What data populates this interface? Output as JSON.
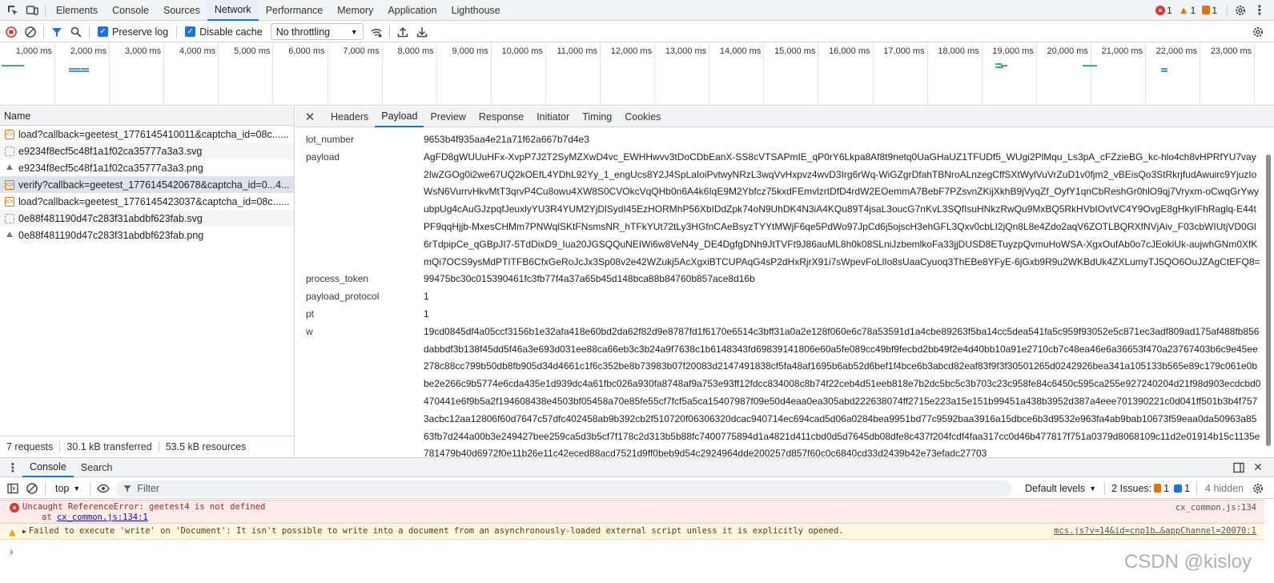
{
  "top_tabs": [
    "Elements",
    "Console",
    "Sources",
    "Network",
    "Performance",
    "Memory",
    "Application",
    "Lighthouse"
  ],
  "active_top_tab": "Network",
  "counters": {
    "errors": "1",
    "warnings": "1",
    "issues": "1"
  },
  "toolbar": {
    "preserve_log": "Preserve log",
    "disable_cache": "Disable cache",
    "throttling": "No throttling"
  },
  "timeline_ticks": [
    "1,000 ms",
    "2,000 ms",
    "3,000 ms",
    "4,000 ms",
    "5,000 ms",
    "6,000 ms",
    "7,000 ms",
    "8,000 ms",
    "9,000 ms",
    "10,000 ms",
    "11,000 ms",
    "12,000 ms",
    "13,000 ms",
    "14,000 ms",
    "15,000 ms",
    "16,000 ms",
    "17,000 ms",
    "18,000 ms",
    "19,000 ms",
    "20,000 ms",
    "21,000 ms",
    "22,000 ms",
    "23,000 ms"
  ],
  "requests_header": "Name",
  "requests": [
    {
      "name": "load?callback=geetest_1776145410011&captcha_id=08c......",
      "type": "script"
    },
    {
      "name": "e9234f8ecf5c48f1a1f02ca35777a3a3.svg",
      "type": "img"
    },
    {
      "name": "e9234f8ecf5c48f1a1f02ca35777a3a3.png",
      "type": "png"
    },
    {
      "name": "verify?callback=geetest_1776145420678&captcha_id=0...4...",
      "type": "script"
    },
    {
      "name": "load?callback=geetest_1776145423037&captcha_id=08c......",
      "type": "script"
    },
    {
      "name": "0e88f481190d47c283f31abdbf623fab.svg",
      "type": "img"
    },
    {
      "name": "0e88f481190d47c283f31abdbf623fab.png",
      "type": "png"
    }
  ],
  "status": {
    "requests": "7 requests",
    "transferred": "30.1 kB transferred",
    "resources": "53.5 kB resources"
  },
  "detail_tabs": [
    "Headers",
    "Payload",
    "Preview",
    "Response",
    "Initiator",
    "Timing",
    "Cookies"
  ],
  "active_detail_tab": "Payload",
  "payload": [
    {
      "key": "lot_number",
      "value": "9653b4f935aa4e21a71f62a667b7d4e3"
    },
    {
      "key": "payload",
      "value": "AgFD8gWUUuHFx-XvpP7J2T2SyMZXwD4vc_EWHHwvv3tDoCDbEanX-SS8cVTSAPmIE_qP0rY6Lkpa8Af8t9netq0UaGHaUZ1TFUDf5_WUgi2PlMqu_Ls3pA_cFZzieBG_kc-hlo4ch8vHPRfYU7vay2IwZGOg0i2we67UQ2kOEfL4YDhL92Yy_1_engUcs8Y2J4SpLaIoiPvtwyNRzL3wqVvHxpvz4wvD3Irg6rWq-WiGZgrDfahTBNroALnzegCffSXtWylVuVrZuD1v0fjm2_vBEisQo3StRkrjfudAwuirc9YjuzIoWsN6VurrvHkvMtT3qrvP4Cu8owu4XW8S0CVOkcVqQHb0n6A4k6IqE9M2Ybfcz75kxdFEmvlzrtDfD4rdW2EOemmA7BebF7PZsvnZKijXkhB9jVyqZf_OyfY1qnCbReshGr0hlO9qj7Vryxm-oCwqGrYwyubpUg4cAuGJzpqfJeuxlyYU3R4YUM2YjDlSydI45EzHORMhP56XbIDdZpk74oN9UhDK4N3iA4KQu89T4jsaL3oucG7nKvL3SQfIsuHNkzRwQu9MxBQ5RkHVbIOvtVC4Y9OvgE8gHkyIFhRaglq-E44tPF9qqHjjb-MxesCHMm7PNWqlSKtFNsmsNR_hTFkYUt72tLy3HGfnCAeBsyzTYYtMWjF6qe5PdWo97JpCd6j5ojscH3ehGFL3Qxv0cbLI2jQn8L8e4Zdo2aqV6ZOTLBQRXfNVjAiv_F03cbWIUtjVD0Gl6rTdpipCe_qGBpJI7-5TdDixD9_Iua20JGSQQuNEIWi6w8VeN4y_DE4DgfgDNh9JtTVFt9J86auML8h0k08SLniJzbemlkoFa33jjDUSD8ETuyzpQvmuHoWSA-XgxOufAb0o7cJEokiUk-aujwhGNm0XfKmQi7OCS9ysMdPTITFB6CfxGeRoJcJx3Sp08v2e42WZukj5AcXgxiBTCUPAqG4sP2dHxRjrX91i7sWpevFoLlIo8sUaaCyuoq3ThEBe8YFyE-6jGxb9R9u2WKBdUk4ZXLumyTJ5QO6OuJZAgCtEFQ8="
    },
    {
      "key": "process_token",
      "value": "99475bc30c015390461fc3fb77f4a37a65b45d148bca88b84760b857ace8d16b"
    },
    {
      "key": "payload_protocol",
      "value": "1"
    },
    {
      "key": "pt",
      "value": "1"
    },
    {
      "key": "w",
      "value": "19cd0845df4a05ccf3156b1e32afa418e60bd2da62f82d9e8787fd1f6170e6514c3bff31a0a2e128f060e6c78a53591d1a4cbe89263f5ba14cc5dea541fa5c959f93052e5c871ec3adf809ad175af488fb856dabbdf3b138f45dd5f46a3e693d031ee88ca66eb3c3b24a9f7638c1b6148343fd69839141806e60a5fe089cc49bf9fecbd2bb49f2e4d40bb10a91e2710cb7c48ea46e6a36653f470a23767403b6c9e45ee278c88cc799b50db8fb905d34d4661c1f6c352be8b73983b07f20083d2147491838cf5fa48af1695b6ab52d6bef1f4bce6b3abcd82eaf83f9f3f30501265d0242926bea341a105133b565e89c179c061e0bbe2e266c9b5774e6cda435e1d939dc4a61fbc026a930fa8748af9a753e93ff12fdcc834008c8b74f22ceb4d51eeb818e7b2dc5bc5c3b703c23c958fe84c6450c595ca255e927240204d21f98d903ecdcbd0470441e6f9b5a2f194608438e4503bf05458a70e85fe55cf7fcf5a5ca15407987f09e50d4eaa0ea305abd222638074ff2715e223a15e151b99451a438b3952d387a4eee701390221c0d041ff501b3b4f7573acbc12aa12806f60d7647c57dfc402458ab9b392cb2f510720f06306320dcac940714ec694cad5d06a0284bea9951bd77c9592baa3916a15dbce6b3d9532e963fa4ab9bab10673f59eaa0da50963a8563fb7d244a00b3e249427bee259ca5d3b5cf7f178c2d313b5b88fc7400775894d1a4821d411cbd0d5d7645db08dfe8c437f204fcdf4faa317cc0d46b477817f751a0379d8068109c11d2e01914b15c1135e781479b40d6972f0e11b26e11c42eced88acd7521d9ff0beb9d54c2924964dde200257d857f60c0c6840cd33d2439b42e73efadc27703"
    }
  ],
  "drawer": {
    "tabs": [
      "Console",
      "Search"
    ],
    "active": "Console",
    "context": "top",
    "filter_placeholder": "Filter",
    "levels": "Default levels",
    "issues_label": "2 Issues:",
    "issues_warn": "1",
    "issues_info": "1",
    "hidden": "4 hidden"
  },
  "console_messages": {
    "error": {
      "text": "Uncaught ReferenceError: geetest4 is not defined",
      "at_prefix": "at ",
      "at_link": "cx_common.js:134:1",
      "source": "cx_common.js:134"
    },
    "warning": {
      "text": "Failed to execute 'write' on 'Document': It isn't possible to write into a document from an asynchronously-loaded external script unless it is explicitly opened.",
      "source": "mcs.js?v=14&id=cnp1b…&appChannel=20070:1"
    }
  },
  "watermark": "CSDN @kisloy",
  "colors": {
    "accent": "#1a73e8",
    "error": "#dc362e",
    "warning": "#e8a600",
    "info": "#1a73e8",
    "timeline_blue": "#5b8fd4",
    "timeline_green": "#36b37e"
  }
}
